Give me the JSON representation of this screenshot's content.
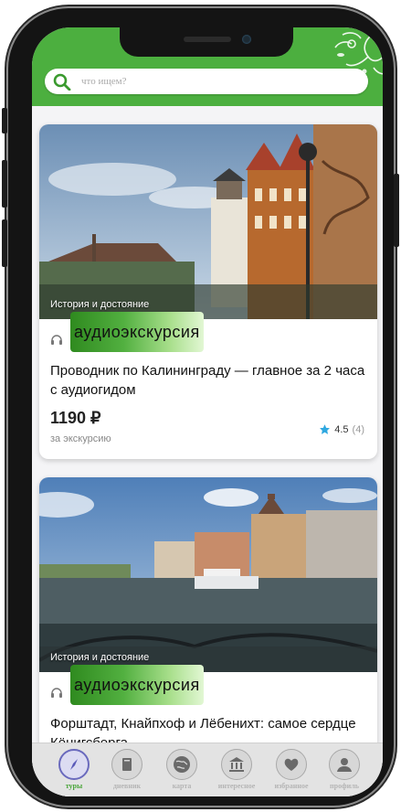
{
  "search": {
    "placeholder": "что ищем?"
  },
  "tours": [
    {
      "category": "История и достояние",
      "badge": "аудиоэкскурсия",
      "title": "Проводник по Калининграду — главное за 2 часа с аудиогидом",
      "price": "1190 ₽",
      "price_note": "за экскурсию",
      "rating": "4.5",
      "reviews": "(4)"
    },
    {
      "category": "История и достояние",
      "badge": "аудиоэкскурсия",
      "title": "Форштадт, Кнайпхоф и Лёбенихт: самое сердце Кёнигсберга"
    }
  ],
  "tabbar": [
    {
      "label": "туры",
      "icon": "compass-icon",
      "active": true
    },
    {
      "label": "дневник",
      "icon": "book-icon"
    },
    {
      "label": "карта",
      "icon": "globe-icon"
    },
    {
      "label": "интересное",
      "icon": "museum-icon"
    },
    {
      "label": "избранное",
      "icon": "heart-icon"
    },
    {
      "label": "профиль",
      "icon": "user-icon"
    }
  ],
  "colors": {
    "header": "#4caf3f",
    "badge": "#52b040",
    "star": "#2fa8e0",
    "active_tab": "#4aa63a"
  }
}
